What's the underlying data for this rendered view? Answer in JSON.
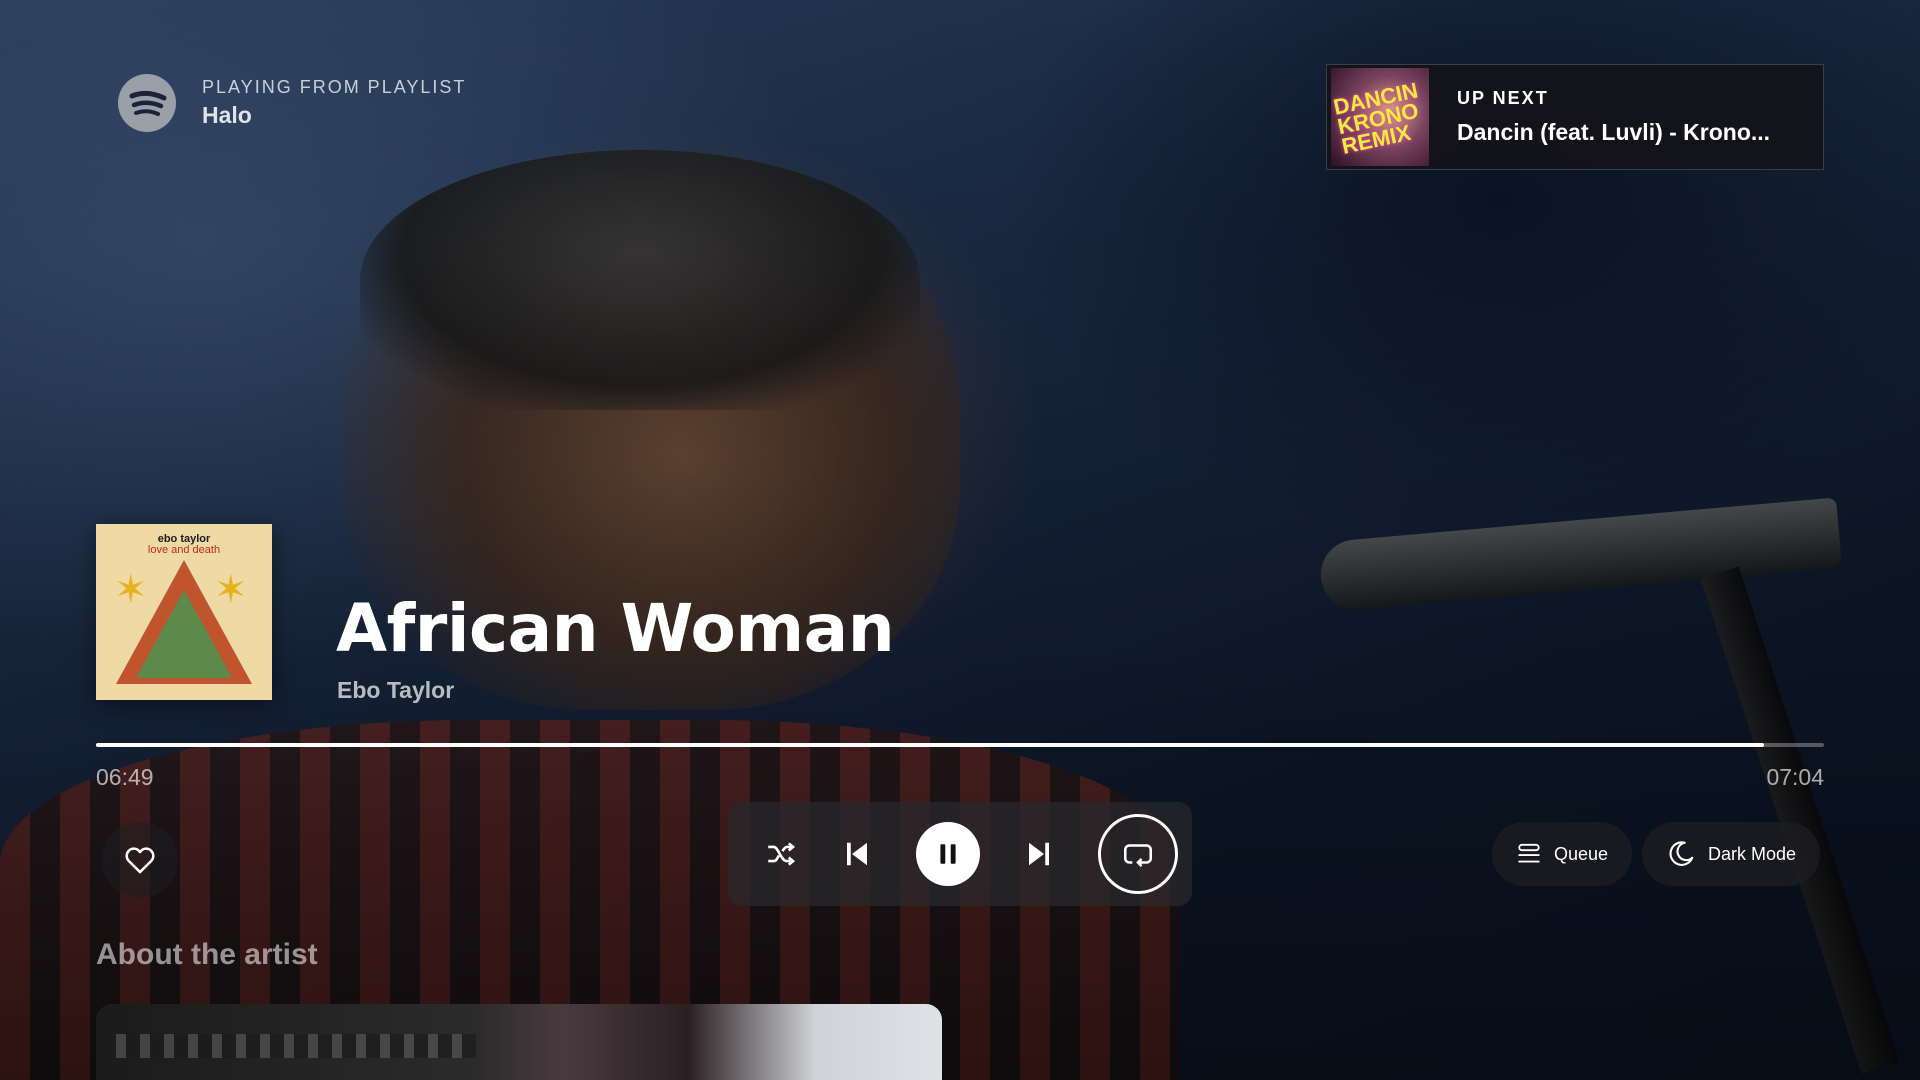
{
  "header": {
    "context_label": "PLAYING FROM PLAYLIST",
    "playlist_name": "Halo"
  },
  "up_next": {
    "label": "UP NEXT",
    "track": "Dancin (feat. Luvli) - Krono...",
    "art_text": "DANCIN KRONO REMIX"
  },
  "now_playing": {
    "title": "African Woman",
    "artist": "Ebo Taylor",
    "album_art_title": "ebo taylor",
    "album_art_subtitle": "love and death"
  },
  "progress": {
    "elapsed": "06:49",
    "total": "07:04",
    "fraction": 0.965
  },
  "controls": {
    "like_icon": "heart-icon",
    "shuffle_icon": "shuffle-icon",
    "previous_icon": "skip-previous-icon",
    "play_state": "playing",
    "pause_icon": "pause-icon",
    "next_icon": "skip-next-icon",
    "repeat_icon": "repeat-icon",
    "queue_label": "Queue",
    "dark_mode_label": "Dark Mode"
  },
  "about": {
    "title": "About the artist"
  },
  "colors": {
    "background": "#0f1a2c",
    "accent": "#ffffff",
    "card": "#141418"
  }
}
